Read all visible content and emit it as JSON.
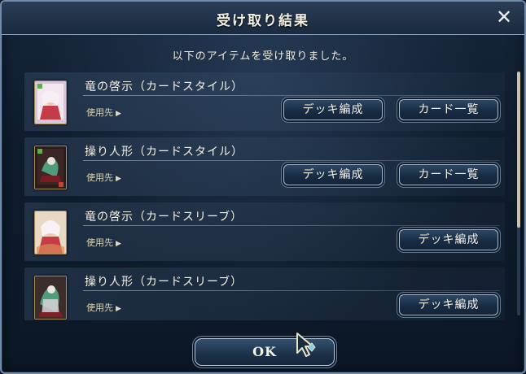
{
  "dialog": {
    "title": "受け取り結果",
    "close_label": "✕",
    "message": "以下のアイテムを受け取りました。",
    "ok_label": "OK"
  },
  "items": [
    {
      "name": "竜の啓示（カードスタイル）",
      "usage": "使用先",
      "buttons": [
        "デッキ編成",
        "カード一覧"
      ]
    },
    {
      "name": "操り人形（カードスタイル）",
      "usage": "使用先",
      "buttons": [
        "デッキ編成",
        "カード一覧"
      ]
    },
    {
      "name": "竜の啓示（カードスリーブ）",
      "usage": "使用先",
      "buttons": [
        "デッキ編成"
      ]
    },
    {
      "name": "操り人形（カードスリーブ）",
      "usage": "使用先",
      "buttons": [
        "デッキ編成"
      ]
    }
  ],
  "icons": {
    "close": "close-icon",
    "usage_arrow": "chevron-right-icon",
    "cursor": "pointer-cursor-icon"
  },
  "colors": {
    "accent_gold": "#b9a46c",
    "panel_bg": "#0f1c2d",
    "button_border": "#9fb6cc"
  },
  "scroll_position": 0
}
